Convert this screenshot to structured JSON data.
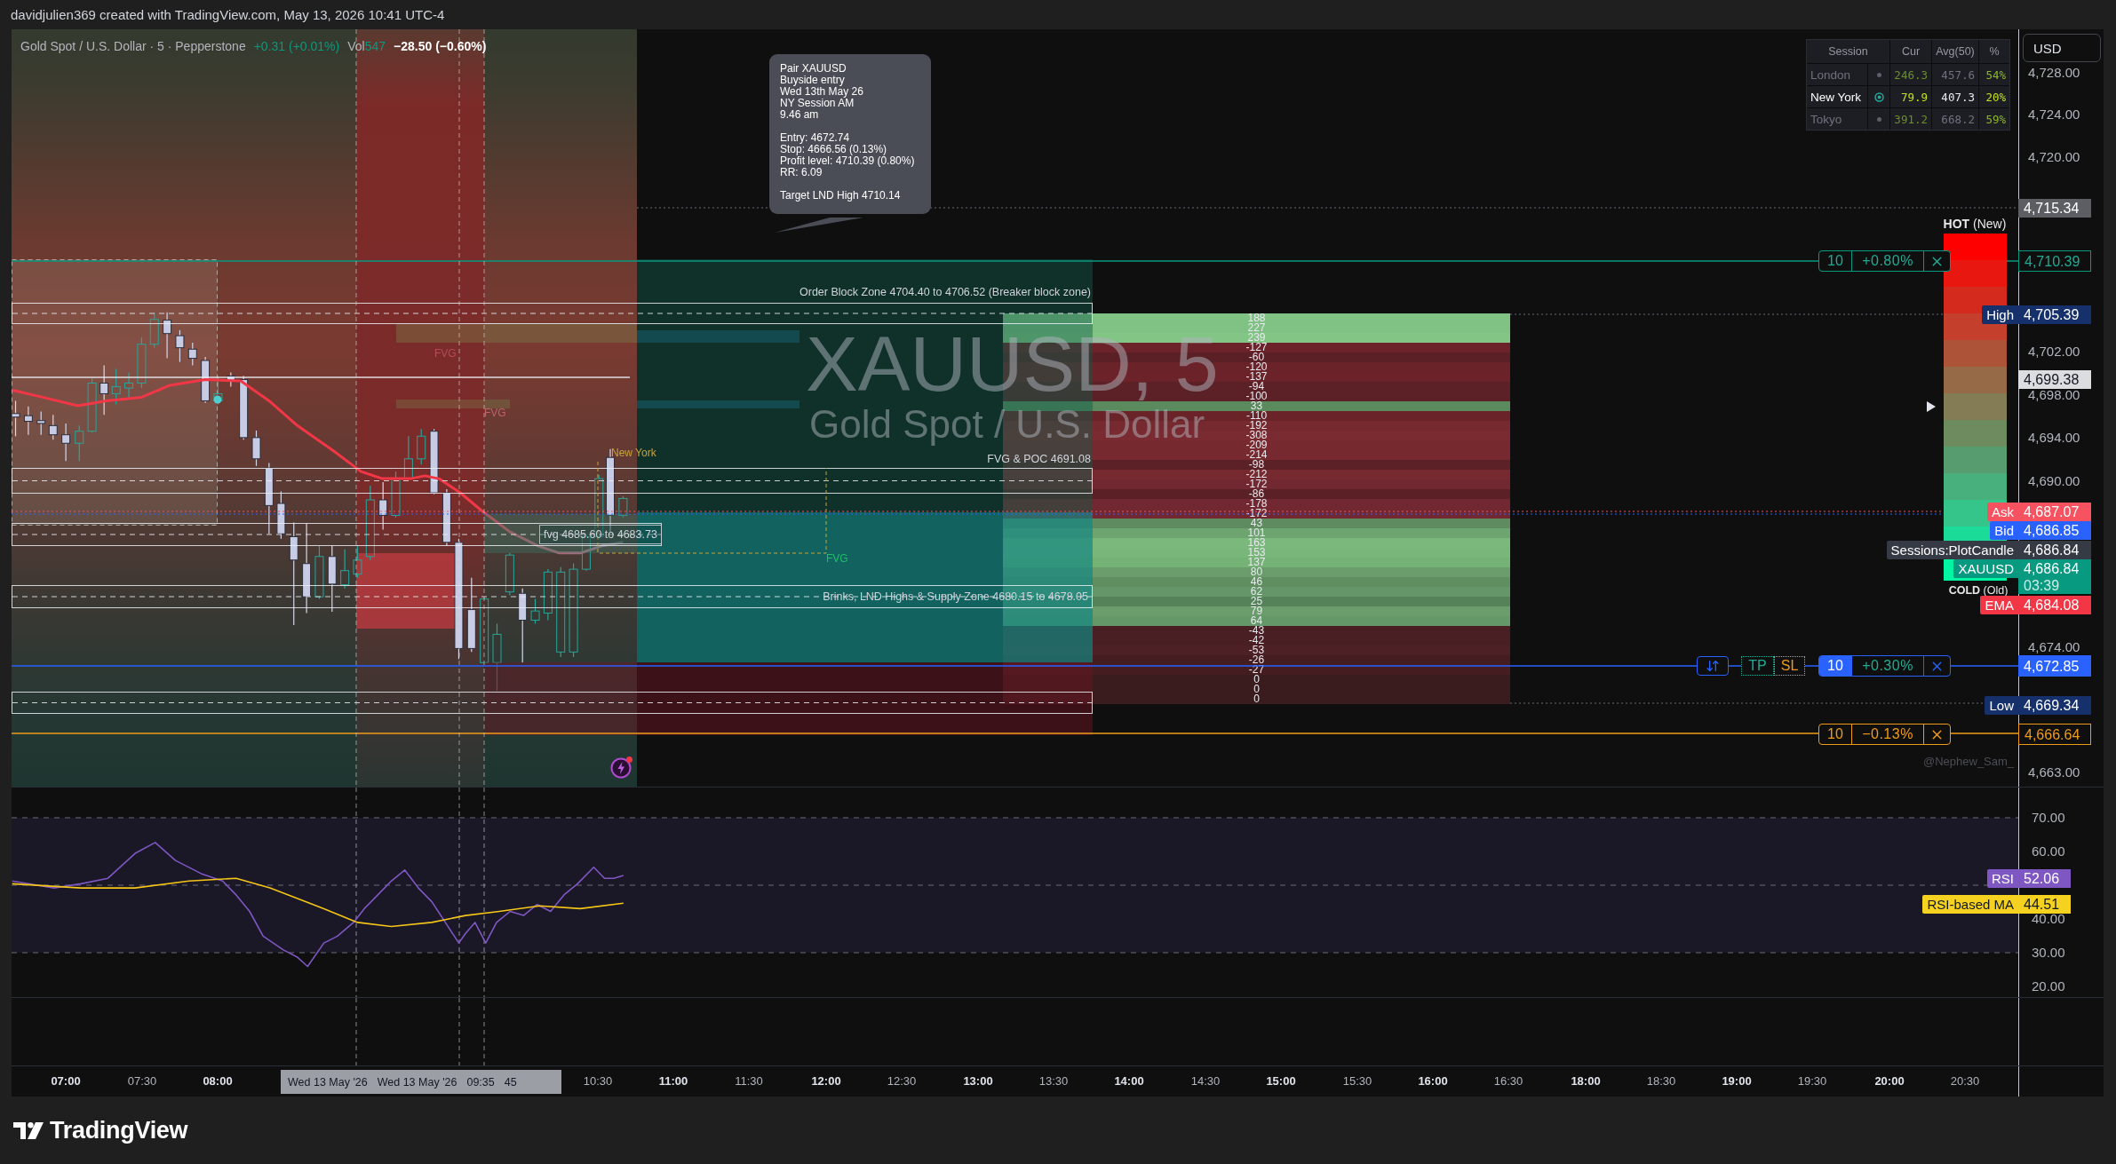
{
  "attribution": "davidjulien369 created with TradingView.com, May 13, 2026 10:41 UTC-4",
  "legend": {
    "title": "Gold Spot / U.S. Dollar · 5 · Pepperstone",
    "change": "+0.31 (+0.01%)",
    "volume_label": "Vol",
    "volume": "547",
    "move": "−28.50 (−0.60%)"
  },
  "watermark": {
    "symbol": "XAUUSD, 5",
    "name": "Gold Spot / U.S. Dollar"
  },
  "trade_note": {
    "paragraphs": [
      [
        "Pair XAUUSD",
        "Buyside entry",
        "Wed 13th May 26",
        "NY Session AM",
        "9.46 am"
      ],
      [
        "Entry: 4672.74",
        "Stop: 4666.56 (0.13%)",
        "Profit level: 4710.39 (0.80%)",
        "RR: 6.09"
      ],
      [
        "Target LND High 4710.14"
      ]
    ]
  },
  "zone_labels": [
    {
      "kind": "order-block",
      "text": "Order Block Zone 4704.40 to 4706.52 (Breaker block zone)"
    },
    {
      "kind": "poc",
      "text": "FVG & POC 4691.08"
    },
    {
      "kind": "fvg",
      "text": "fvg 4685.60 to 4683.73"
    },
    {
      "kind": "supply",
      "text": "Brinks, LND Highs & Supply Zone 4680.15 to 4678.05"
    }
  ],
  "session_label": "New York",
  "fvg_marks": [
    {
      "text": "FVG",
      "color": "#b84a58"
    },
    {
      "text": "FVG",
      "color": "#c2606c"
    },
    {
      "text": "FVG",
      "color": "#1fbf6a"
    }
  ],
  "volume_profile": {
    "rows": [
      {
        "value": "188",
        "color": "#80c283"
      },
      {
        "value": "227",
        "color": "#80c283"
      },
      {
        "value": "239",
        "color": "#82c584"
      },
      {
        "value": "-127",
        "color": "#6b2229"
      },
      {
        "value": "-60",
        "color": "#5a2026"
      },
      {
        "value": "-120",
        "color": "#6a2329"
      },
      {
        "value": "-137",
        "color": "#6b2329"
      },
      {
        "value": "-94",
        "color": "#5c2127"
      },
      {
        "value": "-100",
        "color": "#5c2127"
      },
      {
        "value": "33",
        "color": "#5a8a5e"
      },
      {
        "value": "-110",
        "color": "#6a2329"
      },
      {
        "value": "-192",
        "color": "#762a30"
      },
      {
        "value": "-308",
        "color": "#7a2b31"
      },
      {
        "value": "-209",
        "color": "#762a30"
      },
      {
        "value": "-214",
        "color": "#762a30"
      },
      {
        "value": "-98",
        "color": "#5c2127"
      },
      {
        "value": "-212",
        "color": "#762a30"
      },
      {
        "value": "-172",
        "color": "#722830"
      },
      {
        "value": "-86",
        "color": "#5a2026"
      },
      {
        "value": "-178",
        "color": "#722830"
      },
      {
        "value": "-172",
        "color": "#722830"
      },
      {
        "value": "43",
        "color": "#5e8c60"
      },
      {
        "value": "101",
        "color": "#6ea46f"
      },
      {
        "value": "163",
        "color": "#7ab97b"
      },
      {
        "value": "153",
        "color": "#79b67a"
      },
      {
        "value": "137",
        "color": "#75b276"
      },
      {
        "value": "80",
        "color": "#6a9d6b"
      },
      {
        "value": "46",
        "color": "#5f8f61"
      },
      {
        "value": "62",
        "color": "#64966a"
      },
      {
        "value": "25",
        "color": "#56825a"
      },
      {
        "value": "79",
        "color": "#6a9d6b"
      },
      {
        "value": "64",
        "color": "#659868"
      },
      {
        "value": "-43",
        "color": "#4a1f23"
      },
      {
        "value": "-42",
        "color": "#4a1f23"
      },
      {
        "value": "-53",
        "color": "#4c2024"
      },
      {
        "value": "-26",
        "color": "#451c20"
      },
      {
        "value": "-27",
        "color": "#451c20"
      },
      {
        "value": "0",
        "color": "#3a1b1e"
      },
      {
        "value": "0",
        "color": "#3a1b1e"
      },
      {
        "value": "0",
        "color": "#3a1b1e"
      }
    ]
  },
  "session_table": {
    "columns": [
      "Session",
      "Cur",
      "Avg(50)",
      "%"
    ],
    "rows": [
      {
        "session": "London",
        "active": false,
        "cur": "246.3",
        "avg": "457.6",
        "share": "54%"
      },
      {
        "session": "New York",
        "active": true,
        "cur": "79.9",
        "avg": "407.3",
        "share": "20%"
      },
      {
        "session": "Tokyo",
        "active": false,
        "cur": "391.2",
        "avg": "668.2",
        "share": "59%"
      }
    ]
  },
  "heat_scale": {
    "top": "**HOT** (New)",
    "bottom": "**COLD** (Old)"
  },
  "orders": [
    {
      "kind": "target",
      "quantity": "10",
      "change": "+0.80%"
    },
    {
      "kind": "entry",
      "quantity": "10",
      "change": "+0.30%",
      "tp": "TP",
      "sl": "SL"
    },
    {
      "kind": "stop",
      "quantity": "10",
      "change": "−0.13%"
    }
  ],
  "credit": "@Nephew_Sam_",
  "price_axis": {
    "currency": "USD",
    "ticks": [
      "4,728.00",
      "4,724.00",
      "4,720.00",
      "4,702.00",
      "4,698.00",
      "4,694.00",
      "4,690.00",
      "4,674.00",
      "4,663.00"
    ],
    "labels": [
      {
        "kind": "last",
        "value": "4,715.34"
      },
      {
        "kind": "target",
        "value": "4,710.39"
      },
      {
        "kind": "high",
        "tag": "High",
        "value": "4,705.39"
      },
      {
        "kind": "marker",
        "value": "4,699.38"
      },
      {
        "kind": "ask",
        "tag": "Ask",
        "value": "4,687.07"
      },
      {
        "kind": "bid",
        "tag": "Bid",
        "value": "4,686.85"
      },
      {
        "kind": "study",
        "tag": "Sessions:PlotCandle",
        "value": "4,686.84"
      },
      {
        "kind": "symbol",
        "tag": "XAUUSD",
        "value": "4,686.84",
        "countdown": "03:39"
      },
      {
        "kind": "ema",
        "tag": "EMA",
        "value": "4,684.08"
      },
      {
        "kind": "entry",
        "value": "4,672.85"
      },
      {
        "kind": "low",
        "tag": "Low",
        "value": "4,669.34"
      },
      {
        "kind": "stop",
        "value": "4,666.64"
      }
    ]
  },
  "rsi_axis": {
    "ticks": [
      "70.00",
      "60.00",
      "40.00",
      "30.00",
      "20.00"
    ],
    "labels": [
      {
        "kind": "rsi",
        "tag": "RSI",
        "value": "52.06"
      },
      {
        "kind": "ma",
        "tag": "RSI-based MA",
        "value": "44.51"
      }
    ]
  },
  "time_axis": {
    "ticks": [
      {
        "label": "07:00",
        "major": true
      },
      {
        "label": "07:30",
        "major": false
      },
      {
        "label": "08:00",
        "major": true
      },
      {
        "label": "10:30",
        "major": false
      },
      {
        "label": "11:00",
        "major": true
      },
      {
        "label": "11:30",
        "major": false
      },
      {
        "label": "12:00",
        "major": true
      },
      {
        "label": "12:30",
        "major": false
      },
      {
        "label": "13:00",
        "major": true
      },
      {
        "label": "13:30",
        "major": false
      },
      {
        "label": "14:00",
        "major": true
      },
      {
        "label": "14:30",
        "major": false
      },
      {
        "label": "15:00",
        "major": true
      },
      {
        "label": "15:30",
        "major": false
      },
      {
        "label": "16:00",
        "major": true
      },
      {
        "label": "16:30",
        "major": false
      },
      {
        "label": "18:00",
        "major": true
      },
      {
        "label": "18:30",
        "major": false
      },
      {
        "label": "19:00",
        "major": true
      },
      {
        "label": "19:30",
        "major": false
      },
      {
        "label": "20:00",
        "major": true
      },
      {
        "label": "20:30",
        "major": false
      }
    ],
    "crosshair": [
      "Wed 13 May '26",
      "Wed 13 May '26",
      "09:35",
      "45"
    ]
  },
  "footer": {
    "brand": "TradingView"
  }
}
